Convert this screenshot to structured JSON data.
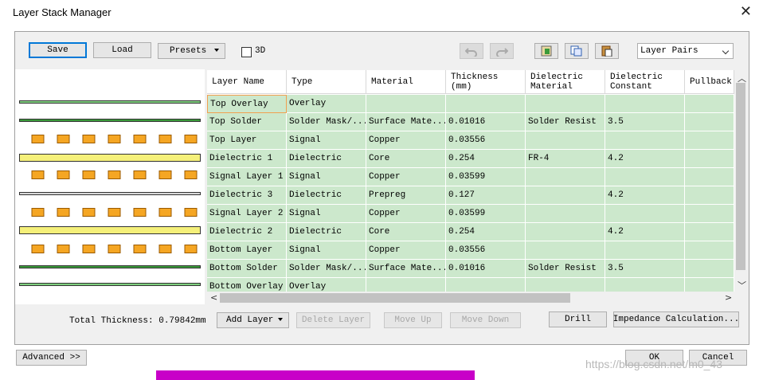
{
  "window": {
    "title": "Layer Stack Manager"
  },
  "toolbar": {
    "save": "Save",
    "load": "Load",
    "presets": "Presets",
    "three_d": "3D",
    "layer_pairs": "Layer Pairs"
  },
  "columns": [
    "Layer Name",
    "Type",
    "Material",
    "Thickness (mm)",
    "Dielectric Material",
    "Dielectric Constant",
    "Pullback"
  ],
  "rows": [
    [
      "Top Overlay",
      "Overlay",
      "",
      "",
      "",
      "",
      ""
    ],
    [
      "Top Solder",
      "Solder Mask/...",
      "Surface Mate...",
      "0.01016",
      "Solder Resist",
      "3.5",
      ""
    ],
    [
      "Top Layer",
      "Signal",
      "Copper",
      "0.03556",
      "",
      "",
      ""
    ],
    [
      "Dielectric 1",
      "Dielectric",
      "Core",
      "0.254",
      "FR-4",
      "4.2",
      ""
    ],
    [
      "Signal Layer 1",
      "Signal",
      "Copper",
      "0.03599",
      "",
      "",
      ""
    ],
    [
      "Dielectric 3",
      "Dielectric",
      "Prepreg",
      "0.127",
      "",
      "4.2",
      ""
    ],
    [
      "Signal Layer 2",
      "Signal",
      "Copper",
      "0.03599",
      "",
      "",
      ""
    ],
    [
      "Dielectric 2",
      "Dielectric",
      "Core",
      "0.254",
      "",
      "4.2",
      ""
    ],
    [
      "Bottom Layer",
      "Signal",
      "Copper",
      "0.03556",
      "",
      "",
      ""
    ],
    [
      "Bottom Solder",
      "Solder Mask/...",
      "Surface Mate...",
      "0.01016",
      "Solder Resist",
      "3.5",
      ""
    ],
    [
      "Bottom Overlay",
      "Overlay",
      "",
      "",
      "",
      "",
      ""
    ]
  ],
  "footer": {
    "total_thickness": "Total Thickness: 0.79842mm",
    "add_layer": "Add Layer",
    "delete_layer": "Delete Layer",
    "move_up": "Move Up",
    "move_down": "Move Down",
    "drill": "Drill",
    "impedance": "Impedance Calculation...",
    "advanced": "Advanced >>",
    "ok": "OK",
    "cancel": "Cancel"
  },
  "watermark": "https://blog.csdn.net/m0_43"
}
